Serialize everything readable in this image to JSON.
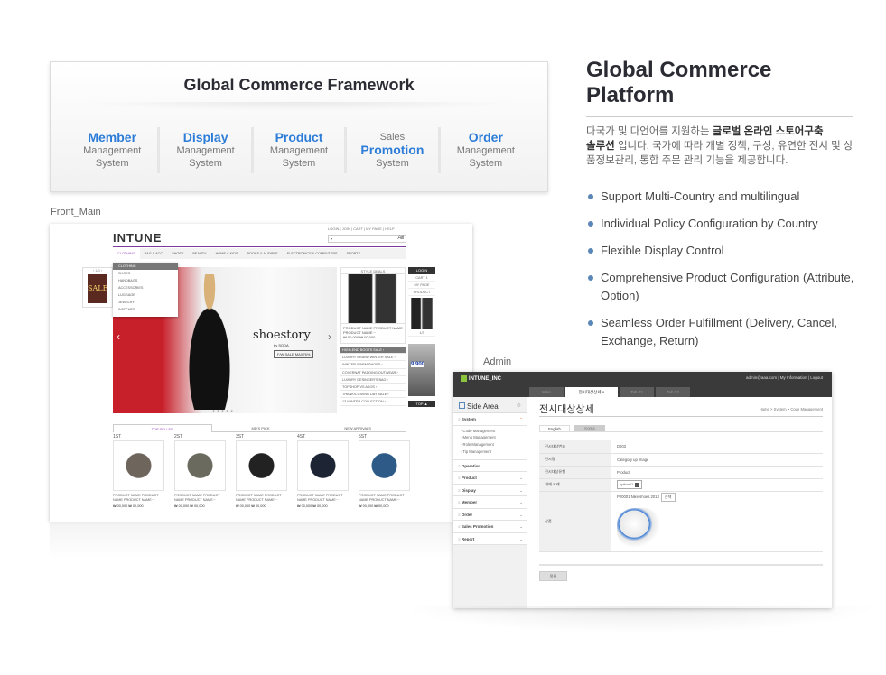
{
  "framework": {
    "title": "Global Commerce Framework",
    "modules": [
      {
        "top": "",
        "accent": "Member",
        "lines": [
          "Management",
          "System"
        ]
      },
      {
        "top": "",
        "accent": "Display",
        "lines": [
          "Management",
          "System"
        ]
      },
      {
        "top": "",
        "accent": "Product",
        "lines": [
          "Management",
          "System"
        ]
      },
      {
        "top": "Sales",
        "accent": "Promotion",
        "lines": [
          "System",
          ""
        ]
      },
      {
        "top": "",
        "accent": "Order",
        "lines": [
          "Management",
          "System"
        ]
      }
    ]
  },
  "platform": {
    "title_line1": "Global Commerce",
    "title_line2": "Platform",
    "desc_pre": "다국가 및 다언어를 지원하는 ",
    "desc_bold1": "글로벌 온라인 스토어구축",
    "desc_bold2": "솔루션",
    "desc_post": " 입니다. 국가에 따라 개별 정책, 구성, 유연한 전시 및 상품정보관리, 통합 주문 관리 기능을 제공합니다.",
    "features": [
      "Support Multi-Country and multilingual",
      "Individual Policy Configuration by Country",
      "Flexible Display Control",
      "Comprehensive Product Configuration (Attribute, Option)",
      "Seamless Order Fulfillment (Delivery, Cancel, Exchange, Return)"
    ]
  },
  "front": {
    "caption": "Front_Main",
    "logo": "INTUNE",
    "top_links": "LOGIN | JOIN | CART | MY PAGE | HELP",
    "search_scope": "All",
    "search_icon": "search-icon",
    "gnb": [
      "CLOTHING",
      "BAG & ACC",
      "SHOES",
      "BEAUTY",
      "HOME & KIDS",
      "BOOKS & AUDIBLE",
      "ELECTRONICS & COMPUTERS",
      "SPORTS"
    ],
    "dropdown": [
      "CLOTHING",
      "SHOES",
      "HANDBAGS",
      "ACCESSORIES",
      "LUGGAGE",
      "JEWELRY",
      "WATCHES"
    ],
    "side_thumb_pager": "1/3",
    "side_thumb_label": "SALE",
    "hero_brand": "shoestory",
    "hero_brand_sub": "by SODA",
    "hero_sub": "F/W SALE MAX76%",
    "style_deals": {
      "title": "STYLE DEALS",
      "product_name": "PRODUCT NAME PRODUCT NAME PRODUCT NAME···",
      "price": "₩ 00,000 ₩ 00,000",
      "list": [
        "HIGH-END BOOTS SALE",
        "LUXURY BRAND WINTER SALE",
        "WINTER WARM SHOES",
        "COVERNAT PADDING OUTWEAR",
        "LUXURY DESINGER'S BAG",
        "TOPSHOP VS ASOS",
        "THANKS-GIVING DAY SALE",
        "13 WINTER COLLECTION"
      ]
    },
    "quick": {
      "login": "LOGIN",
      "cart": "CART 1",
      "mypage": "MY PAGE",
      "product": "PRODUCT",
      "pager": "1/3",
      "banner_price": "9,900",
      "top": "TOP ▲"
    },
    "product_tabs": [
      "TOP SELLER",
      "MD'S PICK",
      "NEW ARRIVALS"
    ],
    "products": [
      {
        "rank": "1ST",
        "name": "PRODUCT NAME PRODUCT NAME PRODUCT NAME···",
        "price": "₩ 00,000 ₩ 00,000"
      },
      {
        "rank": "2ST",
        "name": "PRODUCT NAME PRODUCT NAME PRODUCT NAME···",
        "price": "₩ 00,000 ₩ 00,000"
      },
      {
        "rank": "3ST",
        "name": "PRODUCT NAME PRODUCT NAME PRODUCT NAME···",
        "price": "₩ 00,000 ₩ 00,000"
      },
      {
        "rank": "4ST",
        "name": "PRODUCT NAME PRODUCT NAME PRODUCT NAME···",
        "price": "₩ 00,000 ₩ 00,000"
      },
      {
        "rank": "5ST",
        "name": "PRODUCT NAME PRODUCT NAME PRODUCT NAME···",
        "price": "₩ 00,000 ₩ 00,000"
      }
    ]
  },
  "admin": {
    "caption": "Admin",
    "logo": "INTUNE_INC",
    "links": "admin@aaa.com  |  My Information  |  Logout",
    "tabs": [
      "Main",
      "전시대상상세",
      "Tab 02",
      "Tab 03"
    ],
    "side_title": "Side Area",
    "groups": [
      "System",
      "Operation",
      "Product",
      "Display",
      "Member",
      "Order",
      "Sales Promotion",
      "Report"
    ],
    "system_sub": [
      "Code Management",
      "Menu Management",
      "Role Management",
      "Tip Management"
    ],
    "page_title": "전시대상상세",
    "breadcrumb": "Home > System > Code Management",
    "lang_tabs": [
      "English",
      "Korea"
    ],
    "fields": [
      {
        "label": "전시대상번호",
        "value": "D003"
      },
      {
        "label": "전시명",
        "value": "Category up image"
      },
      {
        "label": "전시대상유형",
        "value": "Product"
      },
      {
        "label": "게재 코레",
        "value": "option01"
      },
      {
        "label": "상품",
        "value": "P00001 Nike shoes 2013"
      }
    ],
    "select_button": "선택",
    "list_button": "목록"
  }
}
